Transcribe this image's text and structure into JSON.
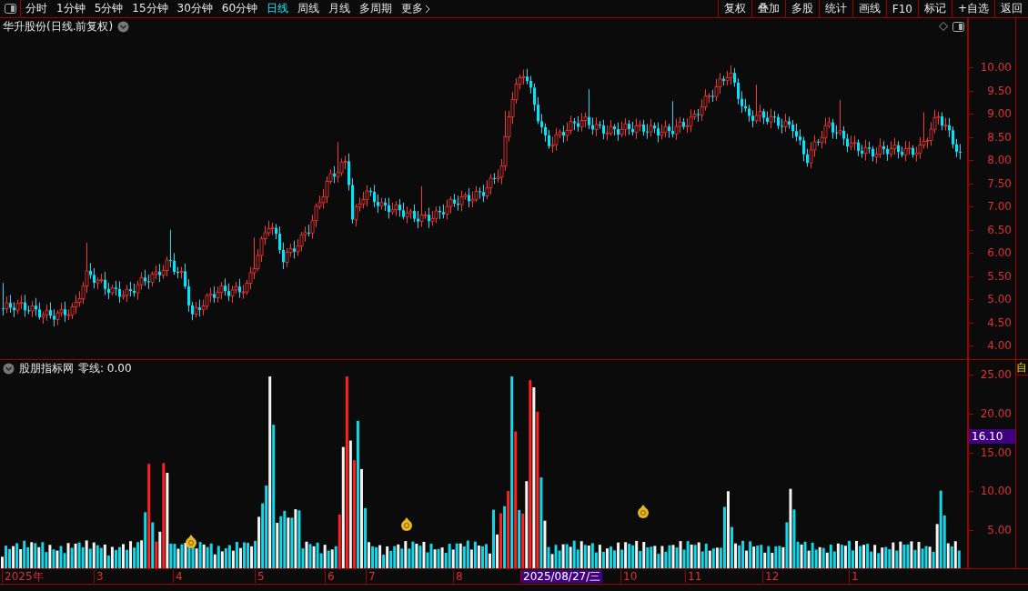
{
  "toolbar": {
    "periods": [
      {
        "label": "分时",
        "selected": false
      },
      {
        "label": "1分钟",
        "selected": false
      },
      {
        "label": "5分钟",
        "selected": false
      },
      {
        "label": "15分钟",
        "selected": false
      },
      {
        "label": "30分钟",
        "selected": false
      },
      {
        "label": "60分钟",
        "selected": false
      },
      {
        "label": "日线",
        "selected": true
      },
      {
        "label": "周线",
        "selected": false
      },
      {
        "label": "月线",
        "selected": false
      },
      {
        "label": "多周期",
        "selected": false
      },
      {
        "label": "更多",
        "selected": false
      }
    ],
    "buttons": [
      "复权",
      "叠加",
      "多股",
      "统计",
      "画线",
      "F10",
      "标记",
      "+自选",
      "返回"
    ]
  },
  "price_pane": {
    "title": "华升股份(日线.前复权)",
    "axis_ticks": [
      "10.00",
      "9.50",
      "9.00",
      "8.50",
      "8.00",
      "7.50",
      "7.00",
      "6.50",
      "6.00",
      "5.50",
      "5.00",
      "4.50",
      "4.00"
    ]
  },
  "indicator_pane": {
    "name": "股朋指标网",
    "reading": "零线: 0.00",
    "axis_ticks": [
      "25.00",
      "20.00",
      "15.00",
      "10.00",
      "5.00"
    ],
    "cursor_value": "16.10",
    "side_label": "自"
  },
  "date_axis": [
    {
      "label": "2025年",
      "selected": false
    },
    {
      "label": "3",
      "selected": false
    },
    {
      "label": "4",
      "selected": false
    },
    {
      "label": "5",
      "selected": false
    },
    {
      "label": "6",
      "selected": false
    },
    {
      "label": "7",
      "selected": false
    },
    {
      "label": "8",
      "selected": false
    },
    {
      "label": "2025/08/27/三",
      "selected": true
    },
    {
      "label": "10",
      "selected": false
    },
    {
      "label": "11",
      "selected": false
    },
    {
      "label": "12",
      "selected": false
    },
    {
      "label": "1",
      "selected": false
    }
  ]
}
